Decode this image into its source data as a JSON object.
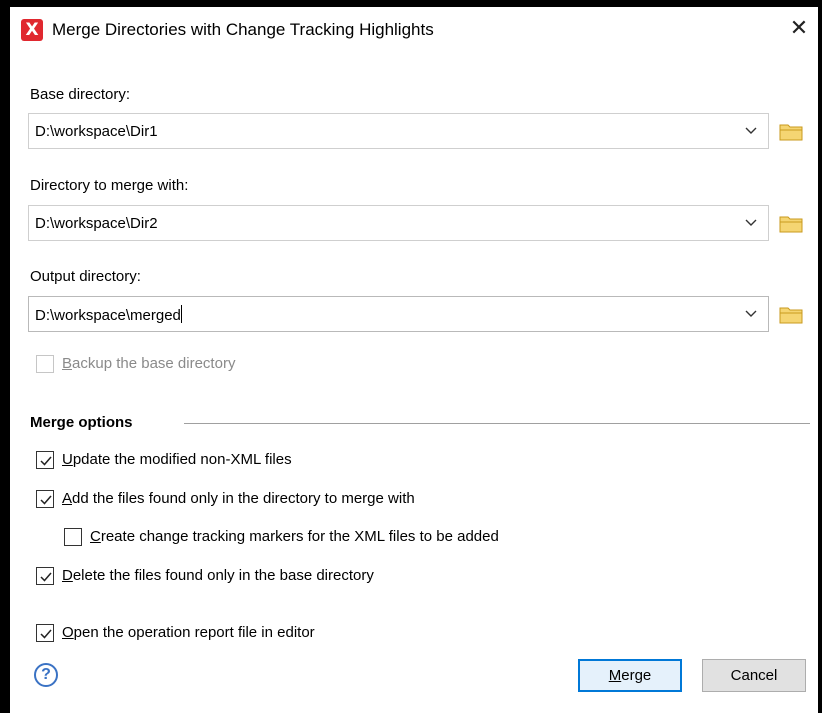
{
  "window": {
    "title": "Merge Directories with Change Tracking Highlights",
    "close_glyph": "✕",
    "app_icon_glyph": "X"
  },
  "fields": {
    "base": {
      "label": "Base directory:",
      "value": "D:\\workspace\\Dir1"
    },
    "merge_with": {
      "label": "Directory to merge with:",
      "value": "D:\\workspace\\Dir2"
    },
    "output": {
      "label": "Output directory:",
      "value": "D:\\workspace\\merged"
    }
  },
  "backup": {
    "mnemonic": "B",
    "rest": "ackup the base directory",
    "checked": false,
    "enabled": false
  },
  "merge_options": {
    "title": "Merge options",
    "items": [
      {
        "mnemonic": "U",
        "rest": "pdate the modified non-XML files",
        "checked": true
      },
      {
        "mnemonic": "A",
        "rest": "dd the files found only in the directory to merge with",
        "checked": true
      },
      {
        "mnemonic": "C",
        "rest": "reate change tracking markers for the XML files to be added",
        "checked": false
      },
      {
        "mnemonic": "D",
        "rest": "elete the files found only in the base directory",
        "checked": true
      },
      {
        "mnemonic": "O",
        "rest": "pen the operation report file in editor",
        "checked": true
      }
    ]
  },
  "buttons": {
    "help_glyph": "?",
    "merge": {
      "mnemonic": "M",
      "rest": "erge"
    },
    "cancel": "Cancel"
  },
  "colors": {
    "accent": "#0078d7",
    "folder": "#e8b93c",
    "app_icon": "#e0282f"
  }
}
